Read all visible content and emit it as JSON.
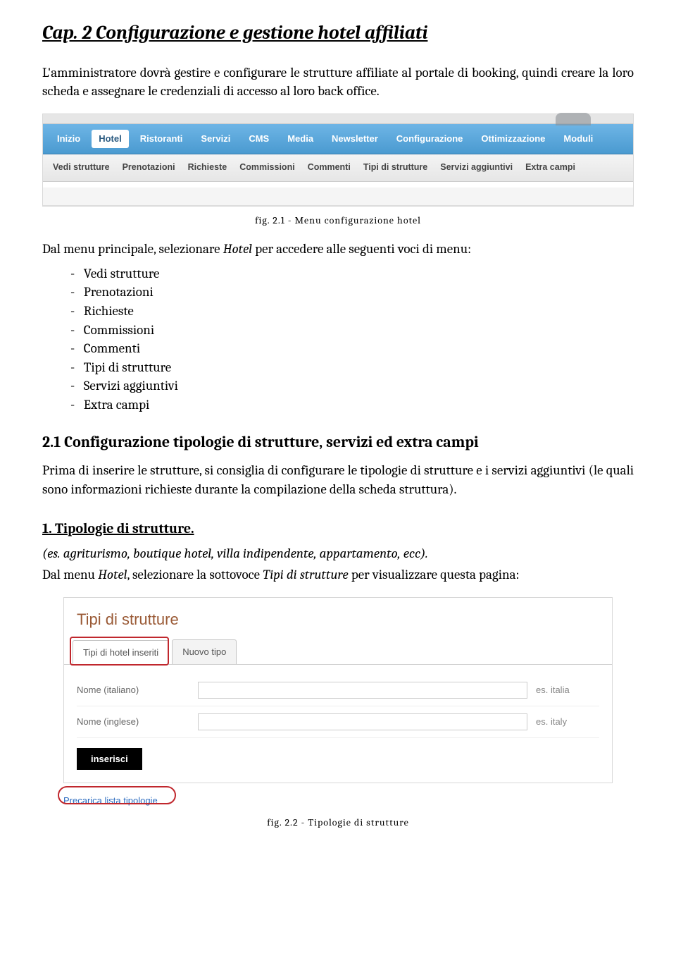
{
  "chapter_title": "Cap. 2 Configurazione e gestione hotel affiliati",
  "para_intro": "L'amministratore dovrà gestire e configurare le strutture affiliate al portale di booking, quindi creare la loro scheda e assegnare le credenziali di accesso al loro back office.",
  "fig21": {
    "primary": [
      "Inizio",
      "Hotel",
      "Ristoranti",
      "Servizi",
      "CMS",
      "Media",
      "Newsletter",
      "Configurazione",
      "Ottimizzazione",
      "Moduli"
    ],
    "active_primary": "Hotel",
    "secondary": [
      "Vedi strutture",
      "Prenotazioni",
      "Richieste",
      "Commissioni",
      "Commenti",
      "Tipi di strutture",
      "Servizi aggiuntivi",
      "Extra campi"
    ],
    "caption": "fig. 2.1 - Menu configurazione hotel"
  },
  "para_menu_intro_a": "Dal menu principale, selezionare ",
  "para_menu_intro_hotel": "Hotel",
  "para_menu_intro_b": " per accedere alle seguenti voci di menu:",
  "menu_items": [
    "Vedi strutture",
    "Prenotazioni",
    "Richieste",
    "Commissioni",
    "Commenti",
    "Tipi di strutture",
    "Servizi aggiuntivi",
    "Extra campi"
  ],
  "section21_title": "2.1 Configurazione tipologie di strutture, servizi ed extra campi",
  "section21_para": "Prima di inserire le strutture, si consiglia di configurare le tipologie di strutture e i servizi aggiuntivi (le quali sono informazioni richieste durante la compilazione della scheda struttura).",
  "sub1_title": "1. Tipologie di strutture.",
  "sub1_example": "(es. agriturismo, boutique hotel, villa indipendente, appartamento, ecc).",
  "sub1_instr_a": "Dal menu ",
  "sub1_instr_hotel": "Hotel",
  "sub1_instr_b": ", selezionare la sottovoce ",
  "sub1_instr_tipi": "Tipi di strutture",
  "sub1_instr_c": " per visualizzare questa pagina:",
  "fig22": {
    "heading": "Tipi di strutture",
    "tab_inserted": "Tipi di hotel inseriti",
    "tab_new": "Nuovo tipo",
    "row_it_label": "Nome (italiano)",
    "row_it_hint": "es. italia",
    "row_en_label": "Nome (inglese)",
    "row_en_hint": "es. italy",
    "submit": "inserisci",
    "precarica": "Precarica lista tipologie",
    "caption": "fig. 2.2 - Tipologie di strutture"
  }
}
